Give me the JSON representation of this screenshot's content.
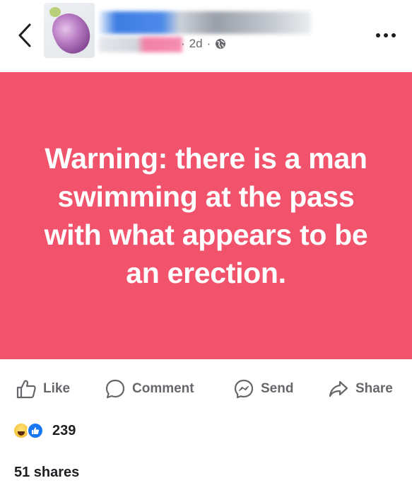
{
  "header": {
    "back_icon": "chevron-left-icon",
    "timestamp": "2d",
    "separator": "·",
    "privacy_icon": "globe-icon",
    "more_icon": "more-horizontal-icon"
  },
  "post": {
    "text": "Warning: there is a man swimming at the pass with what appears to be an erection.",
    "background_color": "#f0536b",
    "text_color": "#ffffff"
  },
  "actions": [
    {
      "label": "Like",
      "icon": "thumbs-up-icon"
    },
    {
      "label": "Comment",
      "icon": "comment-icon"
    },
    {
      "label": "Send",
      "icon": "messenger-icon"
    },
    {
      "label": "Share",
      "icon": "share-arrow-icon"
    }
  ],
  "reactions": {
    "types": [
      "haha",
      "like"
    ],
    "count": "239"
  },
  "shares": "51 shares"
}
